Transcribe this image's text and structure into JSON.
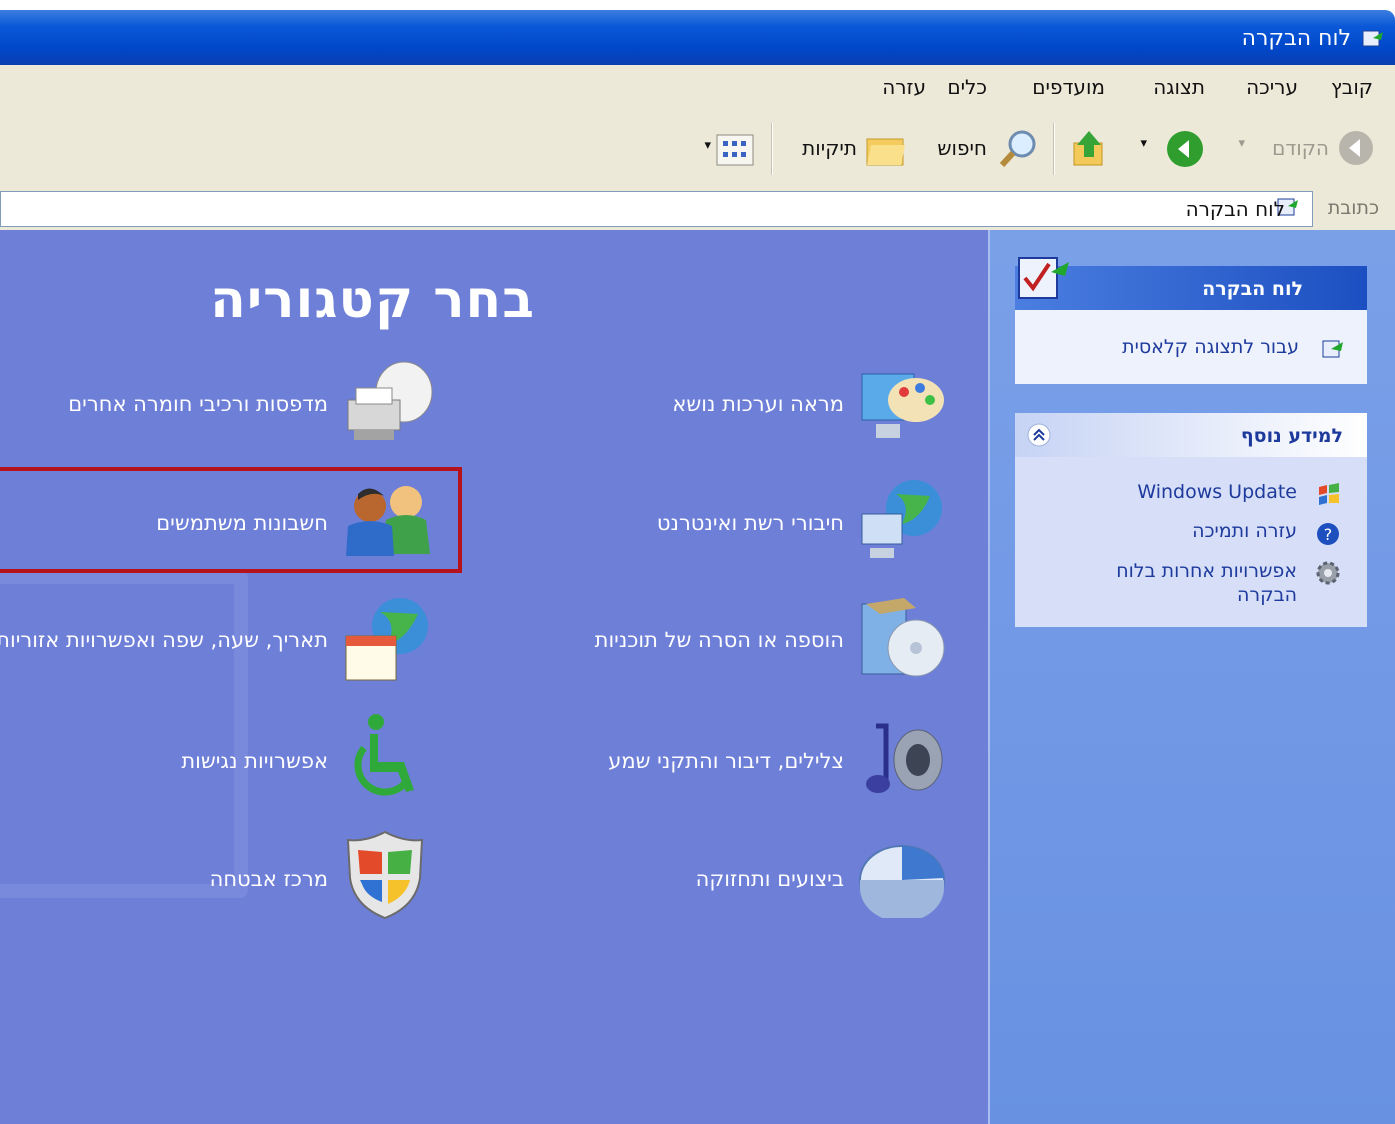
{
  "window": {
    "title": "לוח הבקרה"
  },
  "menu": [
    "קובץ",
    "עריכה",
    "תצוגה",
    "מועדפים",
    "כלים",
    "עזרה"
  ],
  "toolbar": {
    "back_label": "הקודם",
    "search_label": "חיפוש",
    "folders_label": "תיקיות"
  },
  "address": {
    "label": "כתובת",
    "value": "לוח הבקרה"
  },
  "main": {
    "heading": "בחר קטגוריה",
    "categories_right": [
      {
        "label": "מראה וערכות נושא",
        "icon": "appearance-icon"
      },
      {
        "label": "חיבורי רשת ואינטרנט",
        "icon": "network-icon"
      },
      {
        "label": "הוספה או הסרה של תוכניות",
        "icon": "add-remove-programs-icon"
      },
      {
        "label": "צלילים, דיבור והתקני שמע",
        "icon": "sounds-icon"
      },
      {
        "label": "ביצועים ותחזוקה",
        "icon": "performance-icon"
      }
    ],
    "categories_left": [
      {
        "label": "מדפסות ורכיבי חומרה אחרים",
        "icon": "printer-icon"
      },
      {
        "label": "חשבונות משתמשים",
        "icon": "user-accounts-icon"
      },
      {
        "label": "תאריך, שעה, שפה ואפשרויות אזוריות",
        "icon": "date-time-icon"
      },
      {
        "label": "אפשרויות נגישות",
        "icon": "accessibility-icon"
      },
      {
        "label": "מרכז אבטחה",
        "icon": "security-shield-icon"
      }
    ]
  },
  "side": {
    "panel1": {
      "title": "לוח הבקרה",
      "link": "עבור לתצוגה קלאסית"
    },
    "panel2": {
      "title": "למידע נוסף",
      "links": [
        "Windows Update",
        "עזרה ותמיכה",
        "אפשרויות אחרות בלוח הבקרה"
      ]
    }
  },
  "colors": {
    "main_bg": "#6e7fd8",
    "highlight": "#b5121b",
    "titlebar": "#0a58d8"
  }
}
